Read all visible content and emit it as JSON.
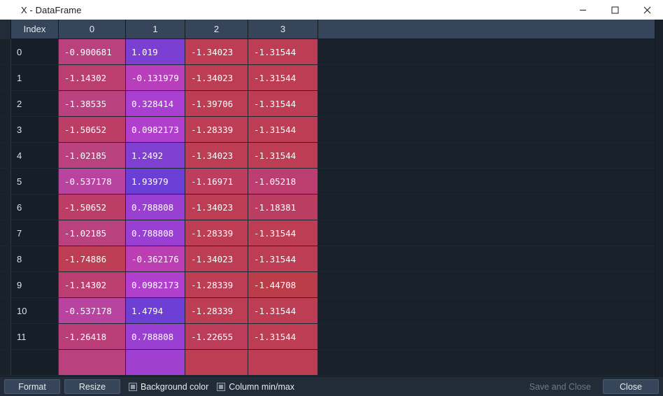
{
  "window": {
    "title": "X - DataFrame",
    "controls": [
      {
        "name": "minimize-button",
        "glyph": "minimize"
      },
      {
        "name": "maximize-button",
        "glyph": "maximize"
      },
      {
        "name": "close-button",
        "glyph": "close"
      }
    ]
  },
  "table": {
    "index_header": "Index",
    "columns": [
      "0",
      "1",
      "2",
      "3"
    ],
    "rows": [
      {
        "index": "0",
        "values": [
          "-0.900681",
          "1.019",
          "-1.34023",
          "-1.31544"
        ]
      },
      {
        "index": "1",
        "values": [
          "-1.14302",
          "-0.131979",
          "-1.34023",
          "-1.31544"
        ]
      },
      {
        "index": "2",
        "values": [
          "-1.38535",
          "0.328414",
          "-1.39706",
          "-1.31544"
        ]
      },
      {
        "index": "3",
        "values": [
          "-1.50652",
          "0.0982173",
          "-1.28339",
          "-1.31544"
        ]
      },
      {
        "index": "4",
        "values": [
          "-1.02185",
          "1.2492",
          "-1.34023",
          "-1.31544"
        ]
      },
      {
        "index": "5",
        "values": [
          "-0.537178",
          "1.93979",
          "-1.16971",
          "-1.05218"
        ]
      },
      {
        "index": "6",
        "values": [
          "-1.50652",
          "0.788808",
          "-1.34023",
          "-1.18381"
        ]
      },
      {
        "index": "7",
        "values": [
          "-1.02185",
          "0.788808",
          "-1.28339",
          "-1.31544"
        ]
      },
      {
        "index": "8",
        "values": [
          "-1.74886",
          "-0.362176",
          "-1.34023",
          "-1.31544"
        ]
      },
      {
        "index": "9",
        "values": [
          "-1.14302",
          "0.0982173",
          "-1.28339",
          "-1.44708"
        ]
      },
      {
        "index": "10",
        "values": [
          "-0.537178",
          "1.4794",
          "-1.28339",
          "-1.31544"
        ]
      },
      {
        "index": "11",
        "values": [
          "-1.26418",
          "0.788808",
          "-1.22655",
          "-1.31544"
        ]
      },
      {
        "index": "",
        "values": [
          "",
          "",
          "",
          ""
        ]
      }
    ],
    "cell_colors": [
      [
        "#b8417e",
        "#7b3fd1",
        "#bc3d54",
        "#bc3d54"
      ],
      [
        "#bb3e70",
        "#b73fbb",
        "#bc3d54",
        "#bc3d54"
      ],
      [
        "#b8417e",
        "#a83fd0",
        "#bc3d54",
        "#bc3d54"
      ],
      [
        "#bc3d66",
        "#b03fcd",
        "#bc3d54",
        "#bc3d54"
      ],
      [
        "#b8417e",
        "#7f3fd0",
        "#bc3d54",
        "#bc3d54"
      ],
      [
        "#b944a0",
        "#6b3fd6",
        "#bc3d5e",
        "#bc3d70"
      ],
      [
        "#bc3d66",
        "#993fd2",
        "#bc3d54",
        "#bc3d62"
      ],
      [
        "#b8417e",
        "#993fd2",
        "#bc3d54",
        "#bc3d54"
      ],
      [
        "#bc3d54",
        "#bb3fb2",
        "#bc3d54",
        "#bc3d54"
      ],
      [
        "#bb3e70",
        "#b03fcd",
        "#bc3d54",
        "#bc3d4a"
      ],
      [
        "#b944a0",
        "#6e3fd5",
        "#bc3d54",
        "#bc3d54"
      ],
      [
        "#ba3f78",
        "#993fd2",
        "#bc3d5a",
        "#bc3d54"
      ],
      [
        "#b8417e",
        "#9f3fd0",
        "#bc3d54",
        "#bc3d54"
      ]
    ]
  },
  "scrollbar": {
    "left_arrow": "◂",
    "right_arrow": "▸"
  },
  "toolbar": {
    "format_label": "Format",
    "resize_label": "Resize",
    "background_color_label": "Background color",
    "background_color_checked": true,
    "column_minmax_label": "Column min/max",
    "column_minmax_checked": true,
    "save_and_close_label": "Save and Close",
    "save_and_close_enabled": false,
    "close_label": "Close"
  }
}
